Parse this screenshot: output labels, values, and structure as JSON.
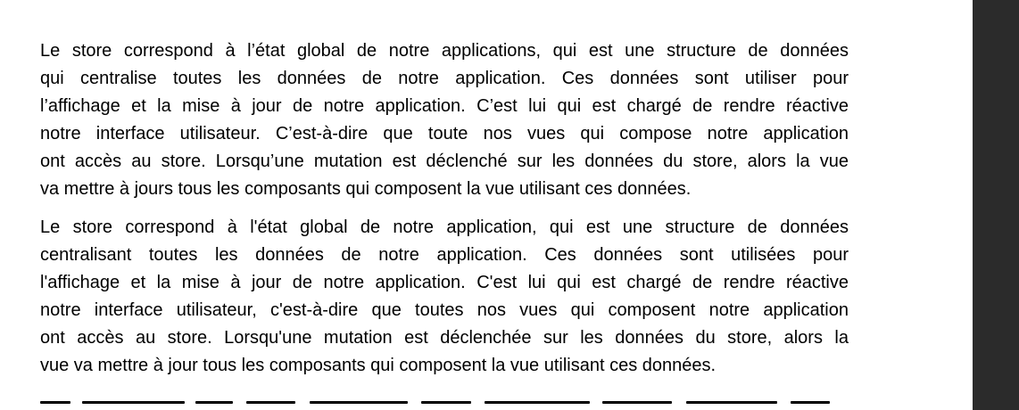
{
  "document": {
    "paragraphs": [
      {
        "lines": [
          "Le store correspond à l’état global de notre applications, qui est une structure de données",
          "qui centralise toutes les données de notre application. Ces données sont utiliser pour",
          "l’affichage et la mise à jour de notre application. C’est lui qui est chargé de rendre réactive",
          "notre interface utilisateur. C’est-à-dire que toute nos vues qui compose notre application",
          "ont accès au store. Lorsqu’une mutation est déclenché sur les données du store, alors la vue",
          "va mettre à jours tous les composants qui composent la vue utilisant ces données."
        ]
      },
      {
        "lines": [
          "Le store correspond à l'état global de notre application, qui est une structure de données",
          "centralisant toutes les données de notre application. Ces données sont utilisées pour",
          "l'affichage et la mise à jour de notre application. C'est lui qui est chargé de rendre réactive",
          "notre interface utilisateur, c'est-à-dire que toutes nos vues qui composent notre application",
          "ont accès au store. Lorsqu'une mutation est déclenchée sur les données du store, alors la",
          "vue va mettre à jour tous les composants qui composent la vue utilisant ces données."
        ]
      }
    ]
  }
}
